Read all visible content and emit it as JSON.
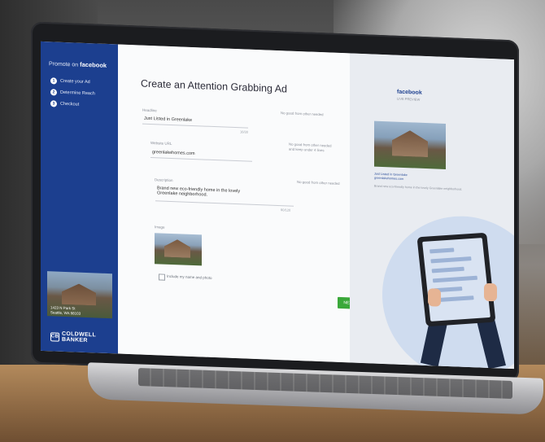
{
  "sidebar": {
    "promote_prefix": "Promote on",
    "promote_brand": "facebook",
    "steps": [
      {
        "num": "1",
        "label": "Create your Ad"
      },
      {
        "num": "2",
        "label": "Determine Reach"
      },
      {
        "num": "3",
        "label": "Checkout"
      }
    ],
    "photo_caption_line1": "1423 N Park St",
    "photo_caption_line2": "Seattle, WA 98103",
    "brand": "COLDWELL BANKER"
  },
  "form": {
    "title": "Create an Attention Grabbing Ad",
    "headline": {
      "label": "Headline",
      "value": "Just Listed in Greenlake",
      "counter": "16/30",
      "hint": "No good from other needed"
    },
    "website": {
      "label": "Website URL",
      "value": "greenlakehomes.com",
      "hint": "No good from other needed and keep under 4 lines"
    },
    "description": {
      "label": "Description",
      "value_line1": "Brand new eco-friendly home in the lovely",
      "value_line2": "Greenlake neighborhood.",
      "counter": "90/120",
      "hint": "No good from other needed"
    },
    "image": {
      "label": "Image",
      "checkbox_label": "Include my name and photo"
    },
    "next_label": "NEXT"
  },
  "preview": {
    "title": "facebook",
    "subtitle": "LIVE PREVIEW",
    "headline": "Just Listed in Greenlake",
    "url": "greenlakehomes.com",
    "description": "Brand new eco-friendly home in the lovely Greenlake neighborhood."
  }
}
